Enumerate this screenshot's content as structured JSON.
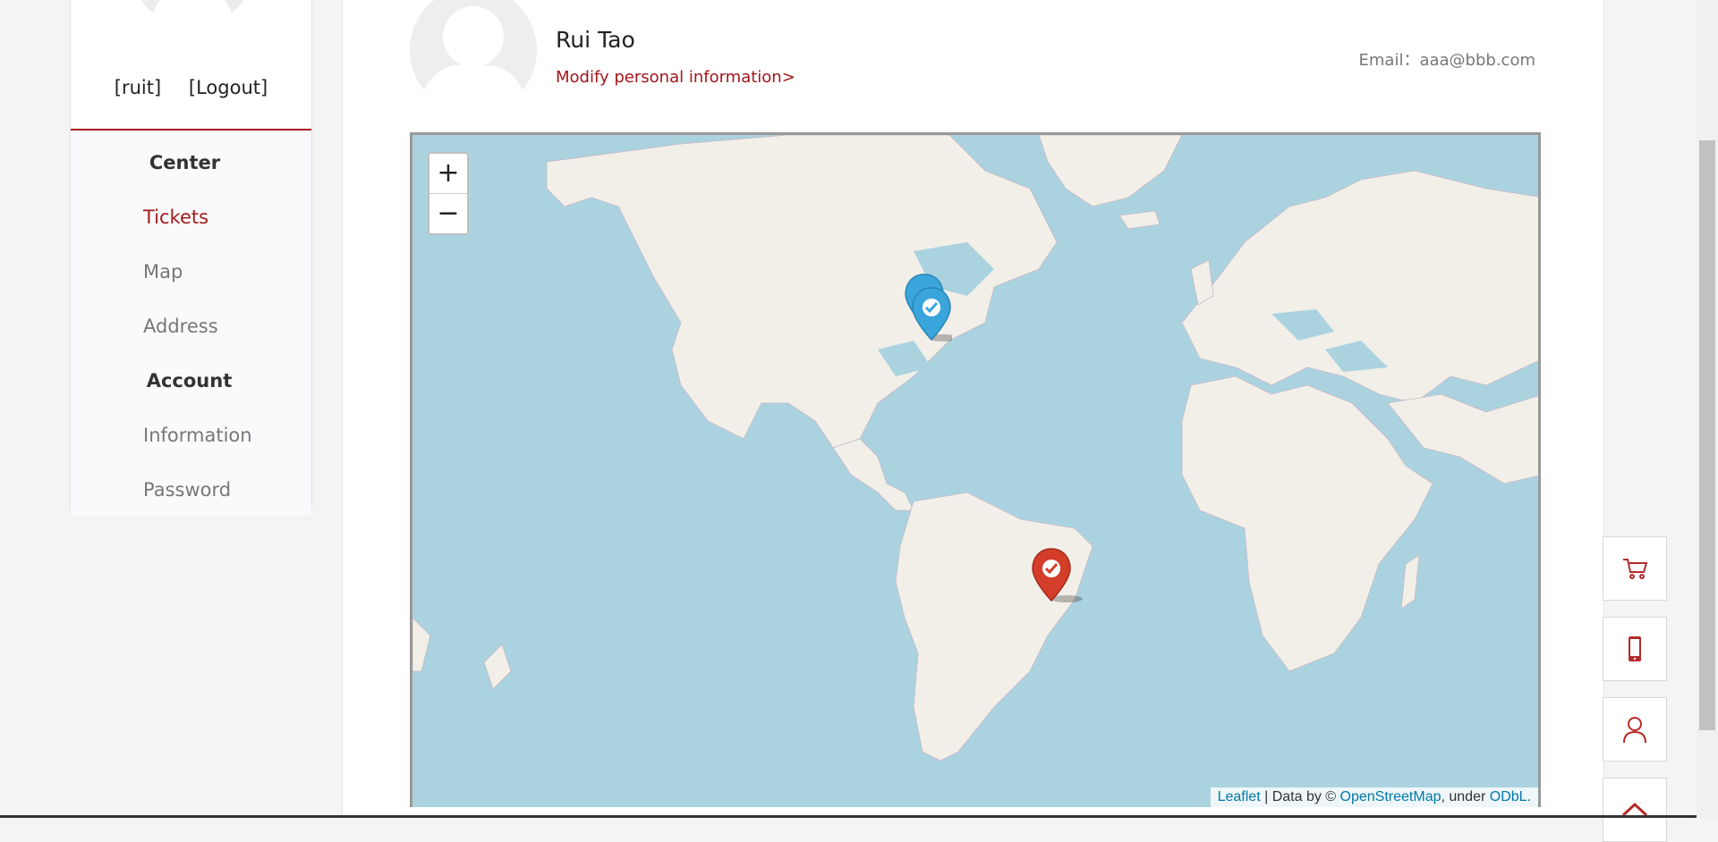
{
  "sidebar": {
    "username": "[ruit]",
    "logout": "[Logout]",
    "menu": {
      "center_label": "Center",
      "tickets": "Tickets",
      "map": "Map",
      "address": "Address",
      "account_label": "Account",
      "information": "Information",
      "password": "Password"
    }
  },
  "profile": {
    "name": "Rui Tao",
    "modify_link": "Modify personal information>",
    "email": "Email：aaa@bbb.com"
  },
  "map": {
    "zoom_in": "+",
    "zoom_out": "−",
    "attribution": {
      "leaflet": "Leaflet",
      "sep": " | Data by © ",
      "osm": "OpenStreetMap",
      "under": ", under ",
      "odbl": "ODbL."
    },
    "markers": [
      {
        "name": "marker-north-america-1",
        "color": "#3aa5dc",
        "icon": "check-icon"
      },
      {
        "name": "marker-north-america-2",
        "color": "#3aa5dc",
        "icon": "check-icon"
      },
      {
        "name": "marker-brazil",
        "color": "#d33d29",
        "icon": "check-icon"
      }
    ]
  },
  "floating_buttons": [
    {
      "name": "cart-button",
      "icon": "cart-icon"
    },
    {
      "name": "mobile-button",
      "icon": "mobile-icon"
    },
    {
      "name": "user-button",
      "icon": "user-icon"
    },
    {
      "name": "back-to-top-button",
      "icon": "chevron-up-icon"
    }
  ],
  "colors": {
    "accent": "#a3151a",
    "water": "#aad3df",
    "land": "#f2efe9"
  }
}
